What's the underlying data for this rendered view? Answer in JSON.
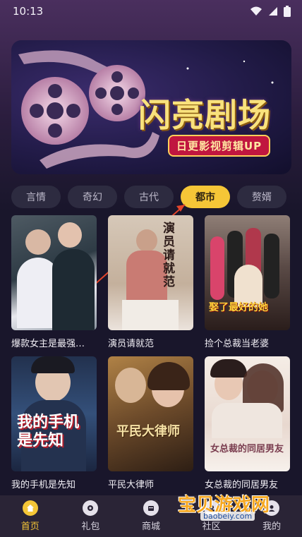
{
  "status_bar": {
    "time": "10:13"
  },
  "banner": {
    "title": "闪亮剧场",
    "subtitle": "日更影视剪辑UP"
  },
  "tabs": [
    "言情",
    "奇幻",
    "古代",
    "都市",
    "赘婿"
  ],
  "cards": [
    {
      "title": "爆款女主是最强…",
      "cover_text": ""
    },
    {
      "title": "演员请就范",
      "cover_text": "演员请就范"
    },
    {
      "title": "捡个总裁当老婆",
      "cover_text": "娶了最好的她"
    },
    {
      "title": "我的手机是先知",
      "cover_text": "我的手机是先知"
    },
    {
      "title": "平民大律师",
      "cover_text": "平民大律师"
    },
    {
      "title": "女总裁的同居男友",
      "cover_text": "女总裁的同居男友"
    }
  ],
  "nav": [
    {
      "label": "首页"
    },
    {
      "label": "礼包"
    },
    {
      "label": "商城"
    },
    {
      "label": "社区"
    },
    {
      "label": "我的"
    }
  ],
  "watermark": {
    "text": "宝贝游戏网",
    "url": "baobeiy.com"
  },
  "colors": {
    "accent": "#f5c637",
    "background": "#19162b",
    "nav_bg": "#2a2436"
  }
}
